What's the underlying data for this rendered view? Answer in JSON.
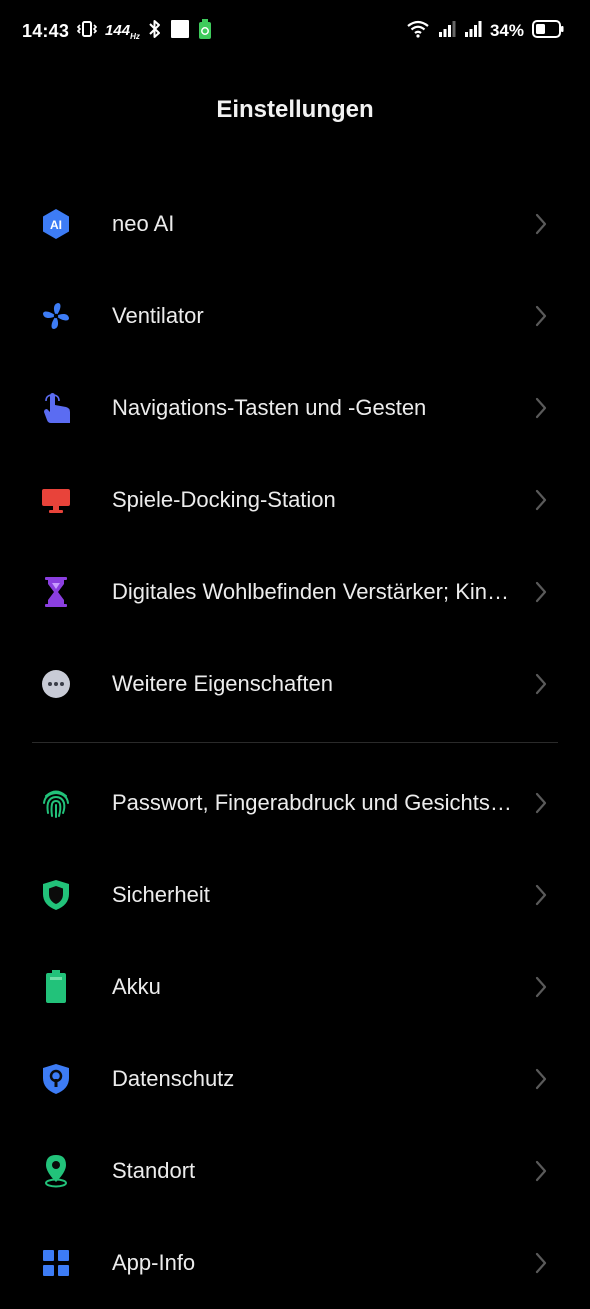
{
  "status_bar": {
    "time": "14:43",
    "refresh_rate": "144",
    "refresh_unit": "Hz",
    "battery_percent": "34%",
    "icons": [
      "vibrate-icon",
      "bluetooth-icon",
      "white-square-icon",
      "battery-saver-icon",
      "wifi-icon",
      "signal-icon",
      "signal-icon",
      "battery-icon"
    ]
  },
  "header": {
    "title": "Einstellungen"
  },
  "group1": [
    {
      "label": "neo AI",
      "icon": "ai-icon",
      "color": "#3d7cf5"
    },
    {
      "label": "Ventilator",
      "icon": "fan-icon",
      "color": "#3d7cf5"
    },
    {
      "label": "Navigations-Tasten und -Gesten",
      "icon": "touch-hand-icon",
      "color": "#5b6cf2"
    },
    {
      "label": "Spiele-Docking-Station",
      "icon": "monitor-icon",
      "color": "#e8433a"
    },
    {
      "label": "Digitales Wohlbefinden Verstärker; Kindersicherung",
      "icon": "hourglass-icon",
      "color": "#8b3fe0"
    },
    {
      "label": "Weitere Eigenschaften",
      "icon": "more-icon",
      "color": "#c8cbd6"
    }
  ],
  "group2": [
    {
      "label": "Passwort, Fingerabdruck und Gesichtserkennung",
      "icon": "fingerprint-icon",
      "color": "#22c27a"
    },
    {
      "label": "Sicherheit",
      "icon": "shield-icon",
      "color": "#22c27a"
    },
    {
      "label": "Akku",
      "icon": "battery-icon",
      "color": "#22c27a"
    },
    {
      "label": "Datenschutz",
      "icon": "privacy-lock-icon",
      "color": "#3d7cf5"
    },
    {
      "label": "Standort",
      "icon": "location-icon",
      "color": "#22c27a"
    },
    {
      "label": "App-Info",
      "icon": "apps-grid-icon",
      "color": "#3d7cf5"
    }
  ]
}
